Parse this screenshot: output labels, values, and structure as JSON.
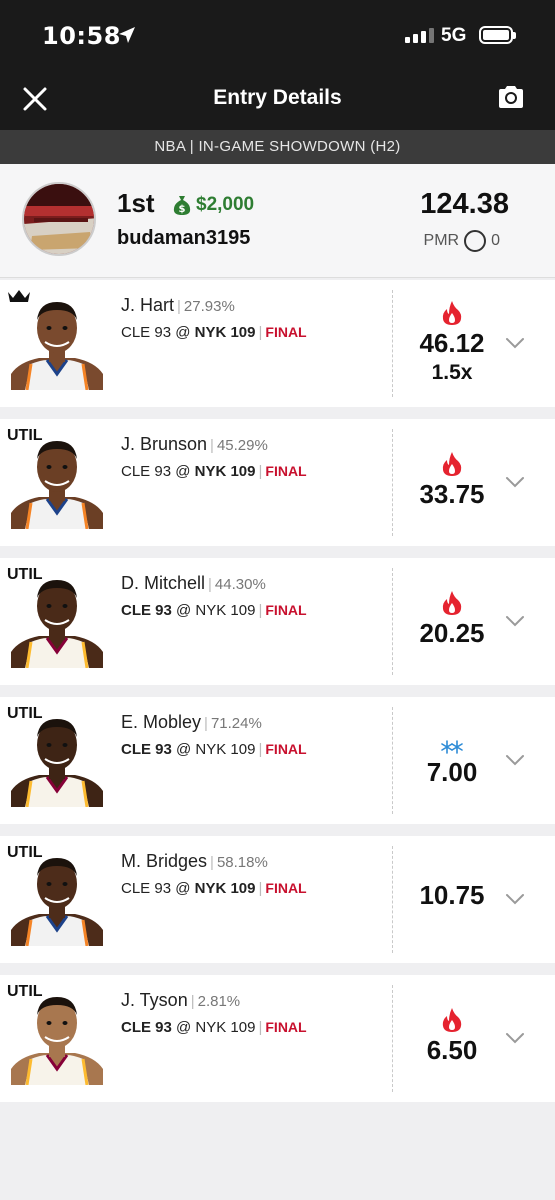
{
  "status_bar": {
    "time": "10:58",
    "network": "5G"
  },
  "nav": {
    "title": "Entry Details",
    "close_icon": "close-icon",
    "camera_icon": "camera-icon"
  },
  "banner": {
    "text": "NBA | IN-GAME SHOWDOWN (H2)"
  },
  "summary": {
    "rank": "1st",
    "prize": "$2,000",
    "prize_icon": "money-bag-icon",
    "username": "budaman3195",
    "total_points": "124.38",
    "pmr_label": "PMR",
    "pmr_value": "0"
  },
  "colors": {
    "win_green": "#2e7d32",
    "final_red": "#c8102e",
    "fire_red": "#e5232f",
    "ice_blue": "#2d8bd6"
  },
  "players": [
    {
      "slot": "",
      "crown": true,
      "name": "J. Hart",
      "ownership": "27.93%",
      "away": "CLE 93",
      "home": "NYK 109",
      "bold_team": "home",
      "status": "FINAL",
      "points": "46.12",
      "multiplier": "1.5x",
      "trend": "fire",
      "team": "NYK",
      "skin": "#7a4a2e"
    },
    {
      "slot": "UTIL",
      "crown": false,
      "name": "J. Brunson",
      "ownership": "45.29%",
      "away": "CLE 93",
      "home": "NYK 109",
      "bold_team": "home",
      "status": "FINAL",
      "points": "33.75",
      "multiplier": "",
      "trend": "fire",
      "team": "NYK",
      "skin": "#6b3f25"
    },
    {
      "slot": "UTIL",
      "crown": false,
      "name": "D. Mitchell",
      "ownership": "44.30%",
      "away": "CLE 93",
      "home": "NYK 109",
      "bold_team": "away",
      "status": "FINAL",
      "points": "20.25",
      "multiplier": "",
      "trend": "fire",
      "team": "CLE",
      "skin": "#4a2a18"
    },
    {
      "slot": "UTIL",
      "crown": false,
      "name": "E. Mobley",
      "ownership": "71.24%",
      "away": "CLE 93",
      "home": "NYK 109",
      "bold_team": "away",
      "status": "FINAL",
      "points": "7.00",
      "multiplier": "",
      "trend": "ice",
      "team": "CLE",
      "skin": "#3e2415"
    },
    {
      "slot": "UTIL",
      "crown": false,
      "name": "M. Bridges",
      "ownership": "58.18%",
      "away": "CLE 93",
      "home": "NYK 109",
      "bold_team": "home",
      "status": "FINAL",
      "points": "10.75",
      "multiplier": "",
      "trend": "none",
      "team": "NYK",
      "skin": "#4d2c1a"
    },
    {
      "slot": "UTIL",
      "crown": false,
      "name": "J. Tyson",
      "ownership": "2.81%",
      "away": "CLE 93",
      "home": "NYK 109",
      "bold_team": "away",
      "status": "FINAL",
      "points": "6.50",
      "multiplier": "",
      "trend": "fire",
      "team": "CLE",
      "skin": "#a8774f"
    }
  ]
}
